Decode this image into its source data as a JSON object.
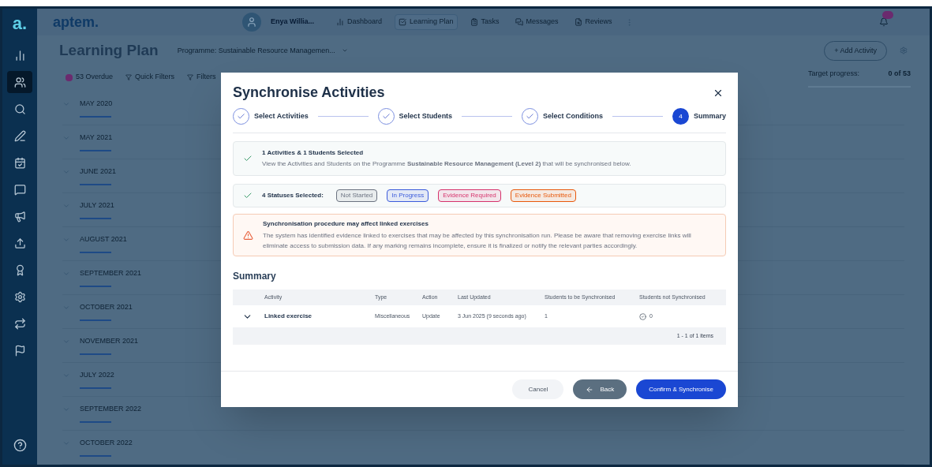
{
  "sidebar": {
    "items": [
      {
        "selected": false
      },
      {
        "selected": true
      },
      {
        "selected": false
      },
      {
        "selected": false
      },
      {
        "selected": false
      },
      {
        "selected": false
      },
      {
        "selected": false
      },
      {
        "selected": false
      },
      {
        "selected": false
      },
      {
        "selected": false
      },
      {
        "selected": false
      },
      {
        "selected": false
      }
    ]
  },
  "topbar": {
    "logo_mark": "a.",
    "logo": "aptem.",
    "user": "Enya Willia...",
    "nav": [
      {
        "label": "Dashboard",
        "selected": false
      },
      {
        "label": "Learning Plan",
        "selected": true
      },
      {
        "label": "Tasks",
        "selected": false
      },
      {
        "label": "Messages",
        "selected": false
      },
      {
        "label": "Reviews",
        "selected": false
      }
    ]
  },
  "page": {
    "title": "Learning Plan",
    "programme": "Programme: Sustainable Resource Managemen...",
    "filters": [
      "53 Overdue",
      "Quick Filters",
      "Filters"
    ],
    "add_button": "+ Add Activity",
    "target_label": "Target progress:",
    "target_value": "0 of 53",
    "months": [
      "MAY 2020",
      "MAY 2021",
      "JUNE 2021",
      "JULY 2021",
      "AUGUST 2021",
      "SEPTEMBER 2021",
      "OCTOBER 2021",
      "NOVEMBER 2021",
      "JULY 2022",
      "SEPTEMBER 2022",
      "OCTOBER 2022"
    ]
  },
  "modal": {
    "title": "Synchronise Activities",
    "steps": [
      {
        "label": "Select Activities",
        "kind": "done"
      },
      {
        "label": "Select Students",
        "kind": "done"
      },
      {
        "label": "Select Conditions",
        "kind": "done"
      },
      {
        "label": "Summary",
        "kind": "current",
        "number": "4"
      }
    ],
    "selection": {
      "title": "1 Activities & 1 Students Selected",
      "text": "View the Activities and Students on the Programme **Sustainable Resource Management (Level 2)** that will be synchronised below."
    },
    "statuses": {
      "title": "4 Statuses Selected:",
      "tags": [
        {
          "label": "Not Started",
          "color": "#6b7280"
        },
        {
          "label": "In Progress",
          "color": "#3b5bdb"
        },
        {
          "label": "Evidence Required",
          "color": "#d6336c"
        },
        {
          "label": "Evidence Submitted",
          "color": "#e8590c"
        }
      ]
    },
    "warning": {
      "title": "Synchronisation procedure may affect linked exercises",
      "text": "The system has identified evidence linked to exercises that may be affected by this synchronisation run. Please be aware that removing exercise links will eliminate access to submission data. If any marking remains incomplete, ensure it is finalized or notify the relevant parties accordingly."
    },
    "summary_title": "Summary",
    "table": {
      "columns": [
        "Activity",
        "Type",
        "Action",
        "Last Updated",
        "Students to be Synchronised",
        "Students not Synchronised"
      ],
      "rows": [
        {
          "activity": "Linked exercise",
          "type": "Miscellaneous",
          "action": "Update",
          "last_updated": "3 Jun 2025 (9 seconds ago)",
          "to_sync": "1",
          "not_sync": "0",
          "expanded": false
        }
      ],
      "pagination": "1 - 1 of 1 items"
    },
    "buttons": {
      "cancel": "Cancel",
      "back": "Back",
      "confirm": "Confirm & Synchronise"
    }
  }
}
